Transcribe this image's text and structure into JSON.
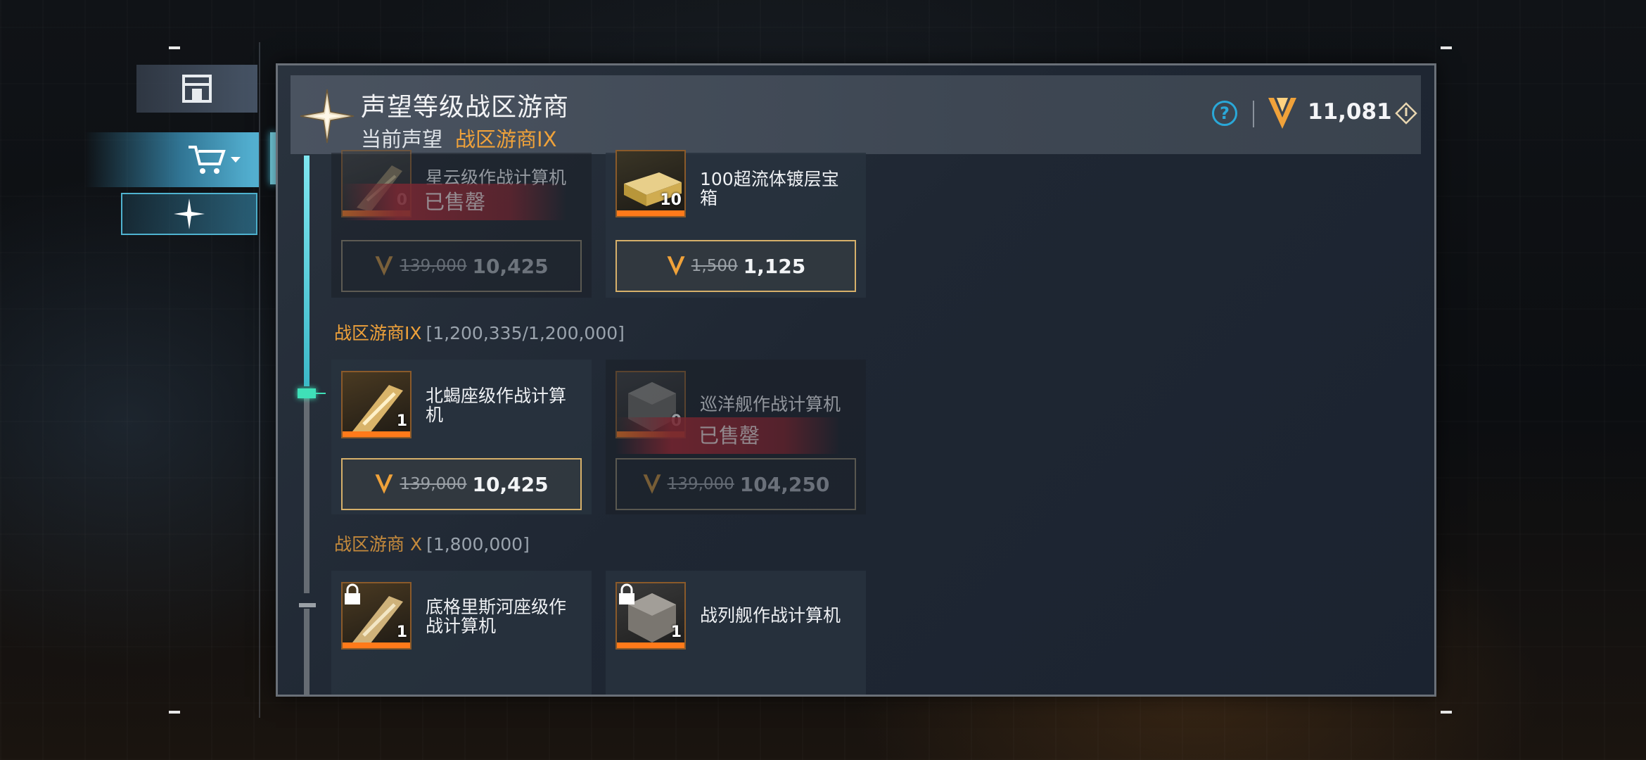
{
  "header": {
    "title": "声望等级战区游商",
    "current_label": "当前声望",
    "current_rank": "战区游商IX",
    "currency_value": "11,081"
  },
  "tiers": [
    {
      "name": "战区游商IX",
      "range": "[1,200,335/1,200,000]"
    },
    {
      "name": "战区游商 X",
      "range": "[1,800,000]"
    }
  ],
  "items": [
    {
      "name": "星云级作战计算机",
      "count": "0",
      "old_price": "139,000",
      "price": "10,425",
      "sold_label": "已售罄"
    },
    {
      "name": "100超流体镀层宝箱",
      "count": "10",
      "old_price": "1,500",
      "price": "1,125"
    },
    {
      "name": "北蝎座级作战计算机",
      "count": "1",
      "old_price": "139,000",
      "price": "10,425"
    },
    {
      "name": "巡洋舰作战计算机",
      "count": "0",
      "old_price": "139,000",
      "price": "104,250",
      "sold_label": "已售罄"
    },
    {
      "name": "底格里斯河座级作战计算机",
      "count": "1"
    },
    {
      "name": "战列舰作战计算机",
      "count": "1"
    }
  ],
  "icons": {
    "nav": [
      "home-icon",
      "cart-icon",
      "star-icon"
    ],
    "currency": "v-currency-icon",
    "help": "help-icon"
  },
  "colors": {
    "accent": "#f0a23a",
    "cyan": "#7fe6f0",
    "sold": "#be232d"
  }
}
